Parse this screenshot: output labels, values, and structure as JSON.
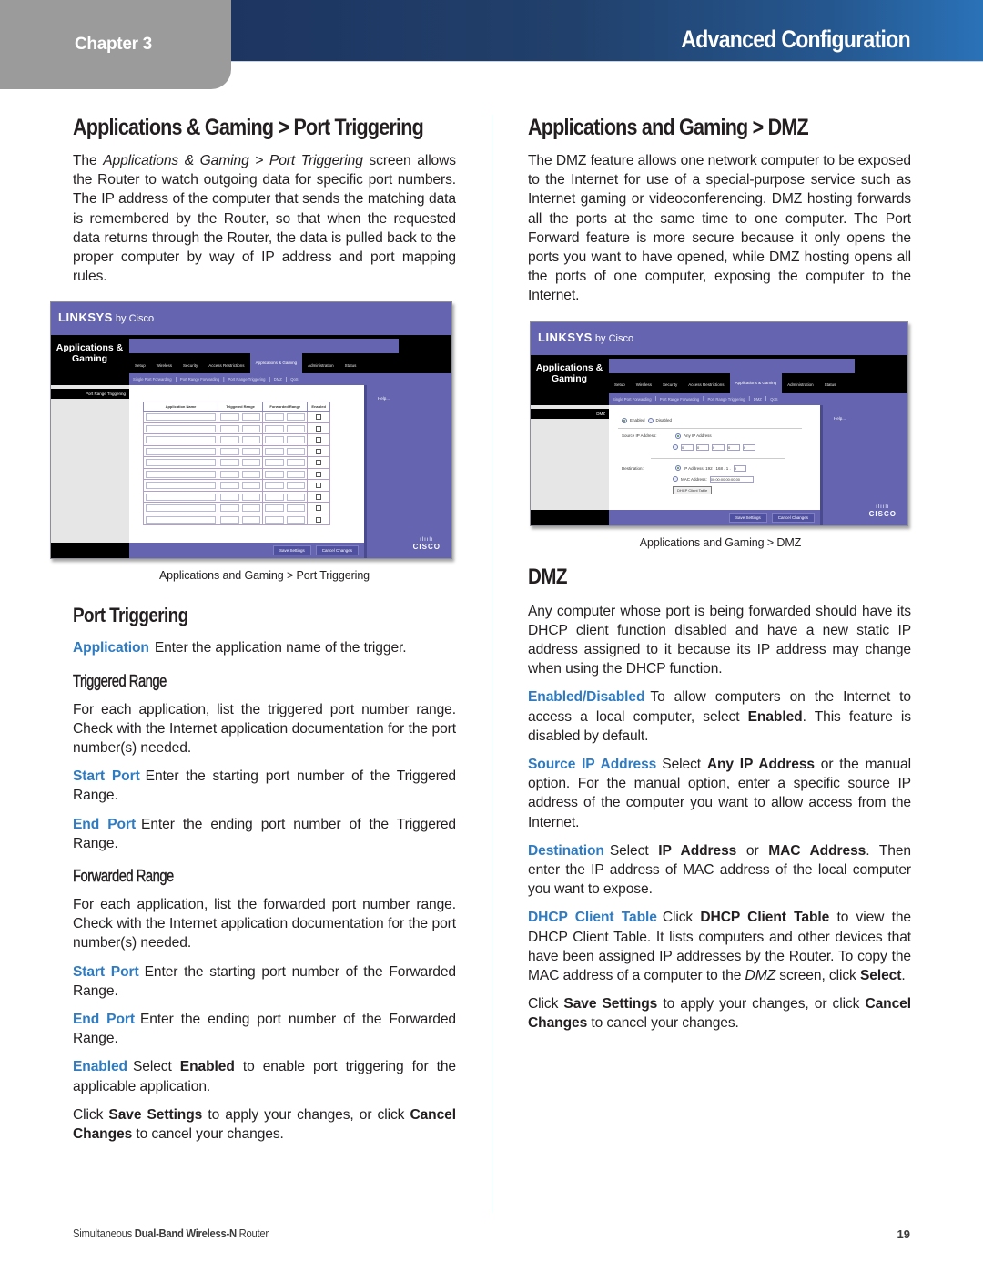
{
  "header": {
    "chapter": "Chapter 3",
    "title": "Advanced Configuration",
    "colors": {
      "chapter_tab": "#9b9b9c",
      "bar_dark": "#1d3561",
      "bar_light": "#2a72b8",
      "term_blue": "#2f7bc1"
    }
  },
  "left": {
    "title": "Applications & Gaming > Port Triggering",
    "intro": {
      "pre": "The ",
      "italic": "Applications & Gaming > Port Triggering",
      "post": " screen allows the Router to watch outgoing data for specific port numbers. The IP address of the computer that sends the matching data is remembered by the Router, so that when the requested data returns through the Router, the data is pulled back to the proper computer by way of IP address and port mapping rules."
    },
    "screenshot": {
      "logo": "LINKSYS",
      "logo_suffix": "by Cisco",
      "section": "Applications & Gaming",
      "tabs": [
        "Setup",
        "Wireless",
        "Security",
        "Access Restrictions",
        "Applications & Gaming",
        "Administration",
        "Status"
      ],
      "active_tab": "Applications & Gaming",
      "subtabs": [
        "Single Port Forwarding",
        "Port Range Forwarding",
        "Port Range Triggering",
        "DMZ",
        "QoS"
      ],
      "left_label": "Port Range Triggering",
      "columns": [
        "Application Name",
        "Triggered Range",
        "Forwarded Range",
        "Enabled"
      ],
      "row_count": 10,
      "help": "Help...",
      "save": "Save Settings",
      "cancel": "Cancel Changes",
      "cisco": "CISCO"
    },
    "caption": "Applications and Gaming > Port Triggering",
    "subsection": "Port Triggering",
    "application": {
      "term": "Application",
      "text": "Enter the application name of the trigger."
    },
    "triggered_range": {
      "title": "Triggered Range",
      "text": "For each application, list the triggered port number range. Check with the Internet application documentation for the port number(s) needed.",
      "start_port": {
        "term": "Start Port",
        "text": "Enter the starting port number of the Triggered Range."
      },
      "end_port": {
        "term": "End Port",
        "text": "Enter the ending port number of the Triggered Range."
      }
    },
    "forwarded_range": {
      "title": "Forwarded Range",
      "text": "For each application, list the forwarded port number range. Check with the Internet application documentation for the port number(s) needed.",
      "start_port": {
        "term": "Start Port",
        "text": "Enter the starting port number of the Forwarded Range."
      },
      "end_port": {
        "term": "End Port",
        "text": "Enter the ending port number of the Forwarded Range."
      }
    },
    "enabled": {
      "term": "Enabled",
      "pre": "Select ",
      "bold": "Enabled",
      "post": " to enable port triggering for the applicable application."
    },
    "closing": {
      "pre": "Click ",
      "save": "Save Settings",
      "mid": " to apply your changes, or click ",
      "cancel": "Cancel Changes",
      "post": " to cancel your changes."
    }
  },
  "right": {
    "title": "Applications and Gaming > DMZ",
    "intro": "The DMZ feature allows one network computer to be exposed to the Internet for use of a special-purpose service such as Internet gaming or videoconferencing. DMZ hosting forwards all the ports at the same time to one computer. The Port Forward feature is more secure because it only opens the ports you want to have opened, while DMZ hosting opens all the ports of one computer, exposing the computer to the Internet.",
    "screenshot": {
      "logo": "LINKSYS",
      "logo_suffix": "by Cisco",
      "section": "Applications & Gaming",
      "tabs": [
        "Setup",
        "Wireless",
        "Security",
        "Access Restrictions",
        "Applications & Gaming",
        "Administration",
        "Status"
      ],
      "active_tab": "Applications & Gaming",
      "subtabs": [
        "Single Port Forwarding",
        "Port Range Forwarding",
        "Port Range Triggering",
        "DMZ",
        "QoS"
      ],
      "left_label": "DMZ",
      "enabled": "Enabled",
      "disabled": "Disabled",
      "source_label": "Source IP Address:",
      "any_ip": "Any IP Address",
      "source_ip_fields": [
        "0",
        "0",
        "0",
        "0",
        "0"
      ],
      "destination_label": "Destination:",
      "ip_address_label": "IP Address: 192 . 168 . 1 .",
      "ip_last_octet": "0",
      "mac_label": "MAC Address:",
      "mac_value": "00:00:00:00:00:00",
      "dhcp_button": "DHCP Client Table",
      "help": "Help...",
      "save": "Save Settings",
      "cancel": "Cancel Changes",
      "cisco": "CISCO"
    },
    "caption": "Applications and Gaming > DMZ",
    "subsection": "DMZ",
    "dmz_text": "Any computer whose port is being forwarded should have its DHCP client function disabled and have a new static IP address assigned to it because its IP address may change when using the DHCP function.",
    "enabled_disabled": {
      "term": "Enabled/Disabled",
      "pre": "To allow computers on the Internet to access a local computer, select ",
      "bold": "Enabled",
      "post": ". This feature is disabled by default."
    },
    "source_ip": {
      "term": "Source IP Address",
      "pre": "Select ",
      "bold": "Any IP Address",
      "post": " or the manual option. For the manual option, enter a specific source IP address of the computer you want to allow access from the Internet."
    },
    "destination": {
      "term": "Destination",
      "pre": "Select ",
      "bold1": "IP Address",
      "mid": " or ",
      "bold2": "MAC Address",
      "post": ". Then enter the IP address of MAC address of the local computer you want to expose."
    },
    "dhcp": {
      "term": "DHCP Client Table",
      "pre": "Click ",
      "bold": "DHCP Client Table",
      "mid": " to view the DHCP Client Table. It lists computers and other devices that have been assigned IP addresses by the Router. To copy the MAC address of a computer to the ",
      "italic": "DMZ",
      "mid2": " screen, click ",
      "bold2": "Select",
      "post": "."
    },
    "closing": {
      "pre": "Click ",
      "save": "Save Settings",
      "mid": " to apply your changes, or click ",
      "cancel": "Cancel Changes",
      "post": " to cancel your changes."
    }
  },
  "footer": {
    "product_pre": "Simultaneous ",
    "product_bold": "Dual-Band Wireless-N",
    "product_post": " Router",
    "page": "19"
  }
}
